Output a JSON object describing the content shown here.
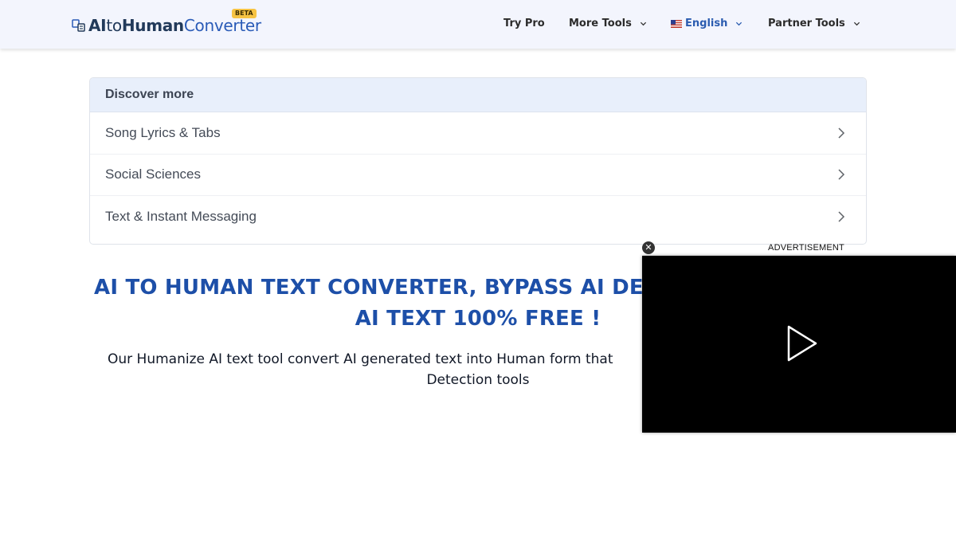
{
  "header": {
    "logo": {
      "part1": "AI",
      "part2": "to",
      "part3": "Human",
      "part4": "Converter",
      "badge": "BETA"
    },
    "nav": {
      "try_pro": "Try Pro",
      "more_tools": "More Tools",
      "language": "English",
      "partner_tools": "Partner Tools"
    }
  },
  "discover": {
    "title": "Discover more",
    "items": [
      {
        "label": "Song Lyrics & Tabs"
      },
      {
        "label": "Social Sciences"
      },
      {
        "label": "Text & Instant Messaging"
      }
    ]
  },
  "hero": {
    "headline_line1": "AI TO HUMAN TEXT CONVERTER, BYPASS AI DET",
    "headline_line2": "AI TEXT 100% FREE !",
    "sub_line1": "Our Humanize AI text tool convert AI generated text into Human form that",
    "sub_line2": "Detection tools"
  },
  "ad": {
    "label": "ADVERTISEMENT",
    "close": "✕"
  },
  "colors": {
    "brand_blue": "#1d4fa8",
    "header_bg": "#f3f5fd",
    "beta_badge": "#f6c343"
  }
}
